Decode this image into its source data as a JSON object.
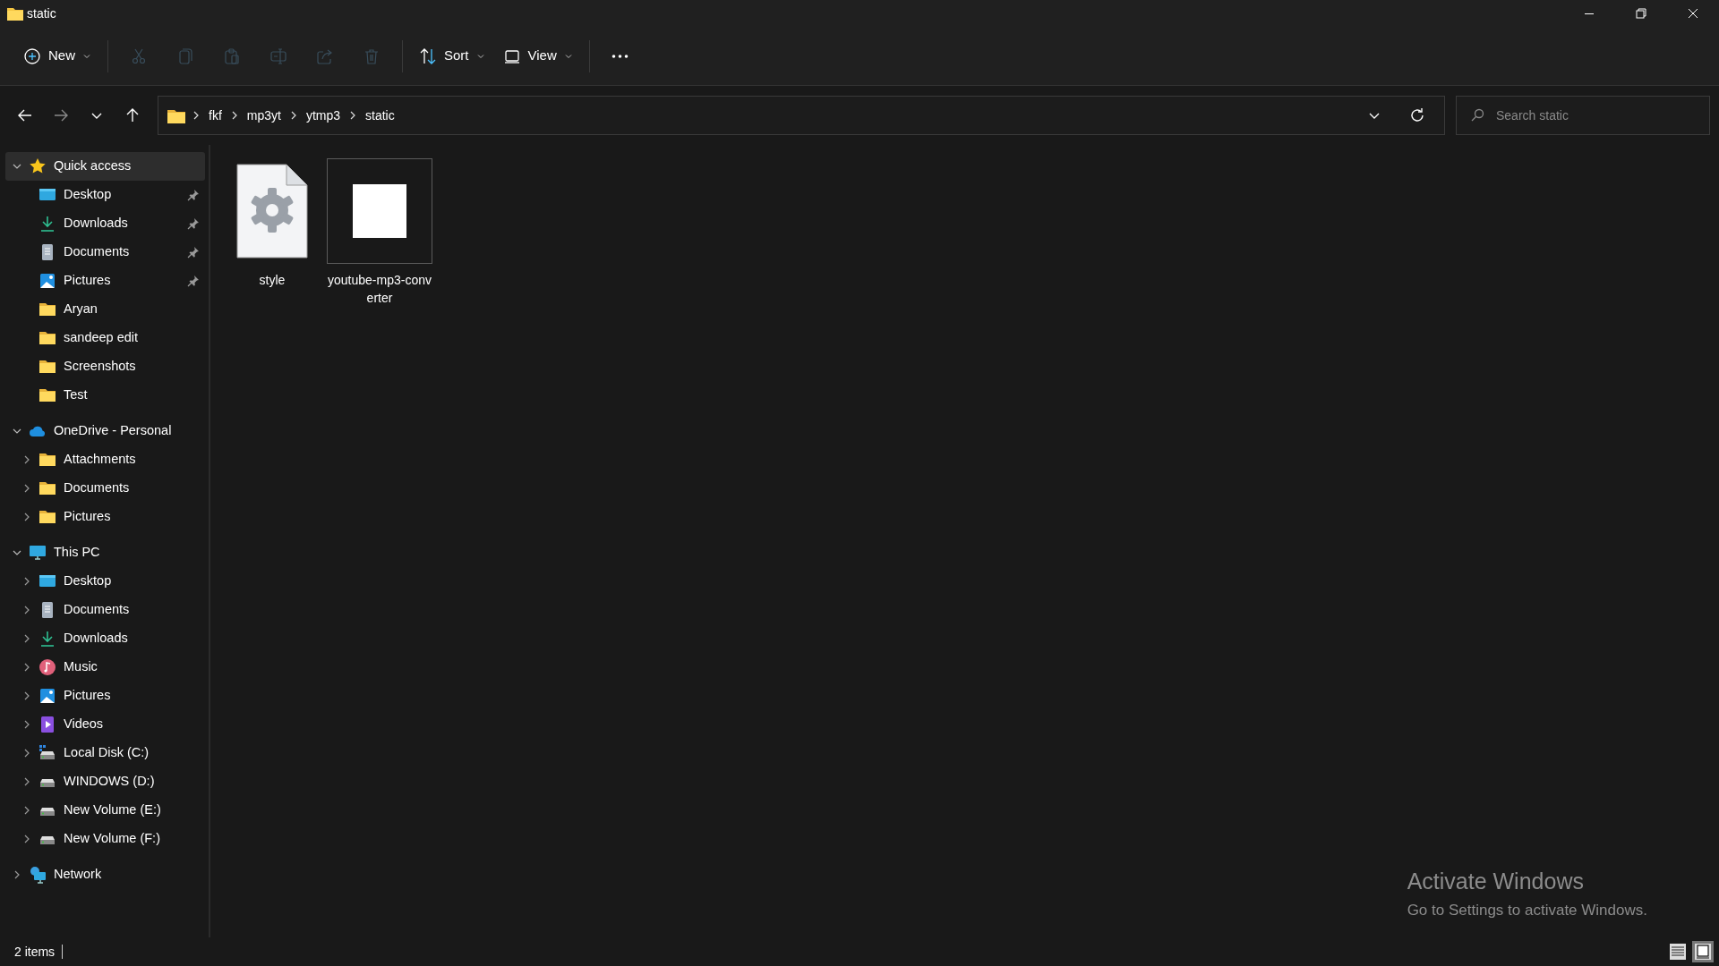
{
  "window": {
    "title": "static"
  },
  "toolbar": [
    {
      "kind": "new",
      "label": "New",
      "disabled": false
    },
    {
      "kind": "cut",
      "disabled": true
    },
    {
      "kind": "copy",
      "disabled": true
    },
    {
      "kind": "paste",
      "disabled": true
    },
    {
      "kind": "rename",
      "disabled": true
    },
    {
      "kind": "share",
      "disabled": true
    },
    {
      "kind": "delete",
      "disabled": true
    },
    {
      "kind": "sort",
      "label": "Sort",
      "disabled": false
    },
    {
      "kind": "view",
      "label": "View",
      "disabled": false
    },
    {
      "kind": "more",
      "disabled": false
    }
  ],
  "navigation": {
    "back_disabled": false,
    "forward_disabled": true
  },
  "address": {
    "path": [
      "fkf",
      "mp3yt",
      "ytmp3",
      "static"
    ]
  },
  "search": {
    "placeholder": "Search static"
  },
  "sidebar": {
    "items": [
      {
        "label": "Quick access",
        "kind": "star",
        "expanded": true,
        "selected": true,
        "children": [
          {
            "label": "Desktop",
            "kind": "desktop",
            "pinned": true,
            "selected": false
          },
          {
            "label": "Downloads",
            "kind": "download",
            "pinned": true,
            "selected": false
          },
          {
            "label": "Documents",
            "kind": "document",
            "pinned": true,
            "selected": false
          },
          {
            "label": "Pictures",
            "kind": "pictures",
            "pinned": true,
            "selected": false
          },
          {
            "label": "Aryan",
            "kind": "folder",
            "pinned": false,
            "selected": false
          },
          {
            "label": "sandeep edit",
            "kind": "folder",
            "pinned": false,
            "selected": false
          },
          {
            "label": "Screenshots",
            "kind": "folder",
            "pinned": false,
            "selected": false
          },
          {
            "label": "Test",
            "kind": "folder",
            "pinned": false,
            "selected": false
          }
        ]
      },
      {
        "label": "OneDrive - Personal",
        "kind": "cloud",
        "expanded": true,
        "selected": false,
        "children": [
          {
            "label": "Attachments",
            "kind": "folder",
            "expanded": false,
            "selected": false
          },
          {
            "label": "Documents",
            "kind": "folder",
            "expanded": false,
            "selected": false
          },
          {
            "label": "Pictures",
            "kind": "folder",
            "expanded": false,
            "selected": false
          }
        ]
      },
      {
        "label": "This PC",
        "kind": "pc",
        "expanded": true,
        "selected": false,
        "children": [
          {
            "label": "Desktop",
            "kind": "desktop",
            "expanded": false,
            "selected": false
          },
          {
            "label": "Documents",
            "kind": "document",
            "expanded": false,
            "selected": false
          },
          {
            "label": "Downloads",
            "kind": "download",
            "expanded": false,
            "selected": false
          },
          {
            "label": "Music",
            "kind": "music",
            "expanded": false,
            "selected": false
          },
          {
            "label": "Pictures",
            "kind": "pictures",
            "expanded": false,
            "selected": false
          },
          {
            "label": "Videos",
            "kind": "videos",
            "expanded": false,
            "selected": false
          },
          {
            "label": "Local Disk (C:)",
            "kind": "system-disk",
            "expanded": false,
            "selected": false
          },
          {
            "label": "WINDOWS (D:)",
            "kind": "disk",
            "expanded": false,
            "selected": false
          },
          {
            "label": "New Volume (E:)",
            "kind": "disk",
            "expanded": false,
            "selected": false
          },
          {
            "label": "New Volume (F:)",
            "kind": "disk",
            "expanded": false,
            "selected": false
          }
        ]
      },
      {
        "label": "Network",
        "kind": "network",
        "expanded": false,
        "selected": false
      }
    ]
  },
  "files": [
    {
      "name": "style",
      "kind": "settings-file",
      "selected": false
    },
    {
      "name": "youtube-mp3-converter",
      "kind": "image",
      "selected": true
    }
  ],
  "status_bar": {
    "count": "2 items",
    "views": [
      {
        "kind": "details",
        "selected": false
      },
      {
        "kind": "large-icons",
        "selected": true
      }
    ]
  },
  "activation_notice": {
    "title": "Activate Windows",
    "message": "Go to Settings to activate Windows."
  }
}
